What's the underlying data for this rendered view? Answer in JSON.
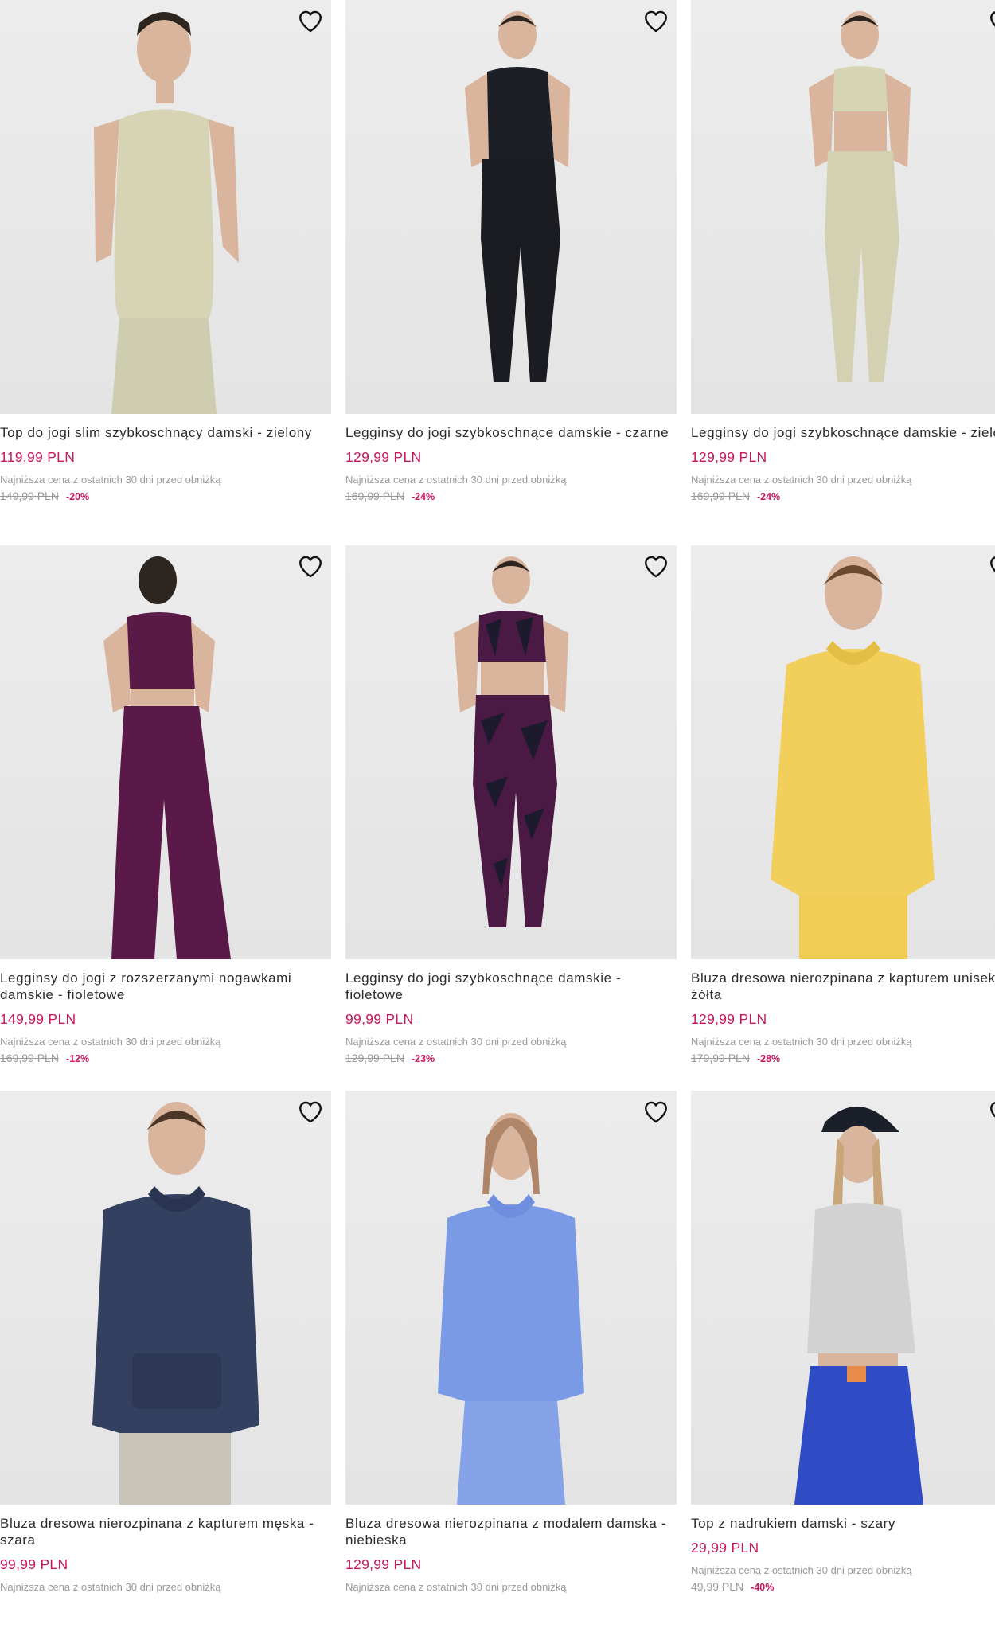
{
  "colors": {
    "price": "#c4175d",
    "muted": "#9a9a9a",
    "text": "#2b2b2b",
    "image_bg": "#e8e8e8"
  },
  "icons": {
    "wishlist": "heart-outline-icon"
  },
  "products": [
    {
      "name": "Top do jogi slim szybkoschnący damski - zielony",
      "price": "119,99 PLN",
      "lowest_label": "Najniższa cena z ostatnich 30 dni przed obniżką",
      "old_price": "149,99 PLN",
      "discount": "-20%"
    },
    {
      "name": "Legginsy do jogi szybkoschnące damskie - czarne",
      "price": "129,99 PLN",
      "lowest_label": "Najniższa cena z ostatnich 30 dni przed obniżką",
      "old_price": "169,99 PLN",
      "discount": "-24%"
    },
    {
      "name": "Legginsy do jogi szybkoschnące damskie - zielone",
      "price": "129,99 PLN",
      "lowest_label": "Najniższa cena z ostatnich 30 dni przed obniżką",
      "old_price": "169,99 PLN",
      "discount": "-24%"
    },
    {
      "name": "Legginsy do jogi z rozszerzanymi nogawkami damskie - fioletowe",
      "price": "149,99 PLN",
      "lowest_label": "Najniższa cena z ostatnich 30 dni przed obniżką",
      "old_price": "169,99 PLN",
      "discount": "-12%"
    },
    {
      "name": "Legginsy do jogi szybkoschnące damskie - fioletowe",
      "price": "99,99 PLN",
      "lowest_label": "Najniższa cena z ostatnich 30 dni przed obniżką",
      "old_price": "129,99 PLN",
      "discount": "-23%"
    },
    {
      "name": "Bluza dresowa nierozpinana z kapturem uniseks - żółta",
      "price": "129,99 PLN",
      "lowest_label": "Najniższa cena z ostatnich 30 dni przed obniżką",
      "old_price": "179,99 PLN",
      "discount": "-28%"
    },
    {
      "name": "Bluza dresowa nierozpinana z kapturem męska - szara",
      "price": "99,99 PLN",
      "lowest_label": "Najniższa cena z ostatnich 30 dni przed obniżką",
      "old_price": "",
      "discount": ""
    },
    {
      "name": "Bluza dresowa nierozpinana z modalem damska - niebieska",
      "price": "129,99 PLN",
      "lowest_label": "Najniższa cena z ostatnich 30 dni przed obniżką",
      "old_price": "",
      "discount": ""
    },
    {
      "name": "Top z nadrukiem damski - szary",
      "price": "29,99 PLN",
      "lowest_label": "Najniższa cena z ostatnich 30 dni przed obniżką",
      "old_price": "49,99 PLN",
      "discount": "-40%"
    }
  ]
}
